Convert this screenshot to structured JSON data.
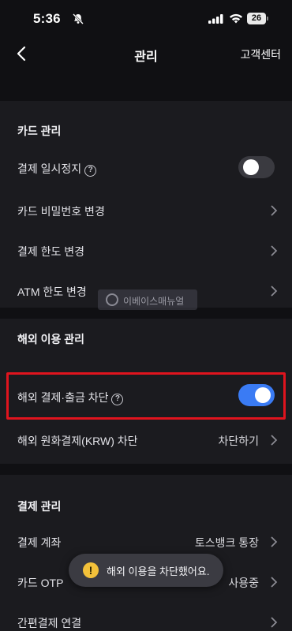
{
  "status_bar": {
    "time": "5:36",
    "battery": "26"
  },
  "nav": {
    "title": "관리",
    "right_label": "고객센터"
  },
  "card_section": {
    "title": "카드 관리",
    "pause_label": "결제 일시정지",
    "pin_label": "카드 비밀번호 변경",
    "limit_label": "결제 한도 변경",
    "atm_label": "ATM 한도 변경"
  },
  "watermark_text": "이베이스매뉴얼",
  "overseas_section": {
    "title": "해외 이용 관리",
    "block_label": "해외 결제·출금 차단",
    "krw_label": "해외 원화결제(KRW) 차단",
    "krw_value": "차단하기"
  },
  "payment_section": {
    "title": "결제 관리",
    "account_label": "결제 계좌",
    "account_value": "토스뱅크 통장",
    "otp_label": "카드 OTP",
    "otp_value": "사용중",
    "simple_label": "간편결제 연결"
  },
  "toast": {
    "message": "해외 이용을 차단했어요."
  },
  "toggles": {
    "pause": "off",
    "overseas_block": "on"
  },
  "colors": {
    "accent": "#3a7bf4",
    "highlight": "#e0141e",
    "toast_icon": "#f3c13a"
  }
}
